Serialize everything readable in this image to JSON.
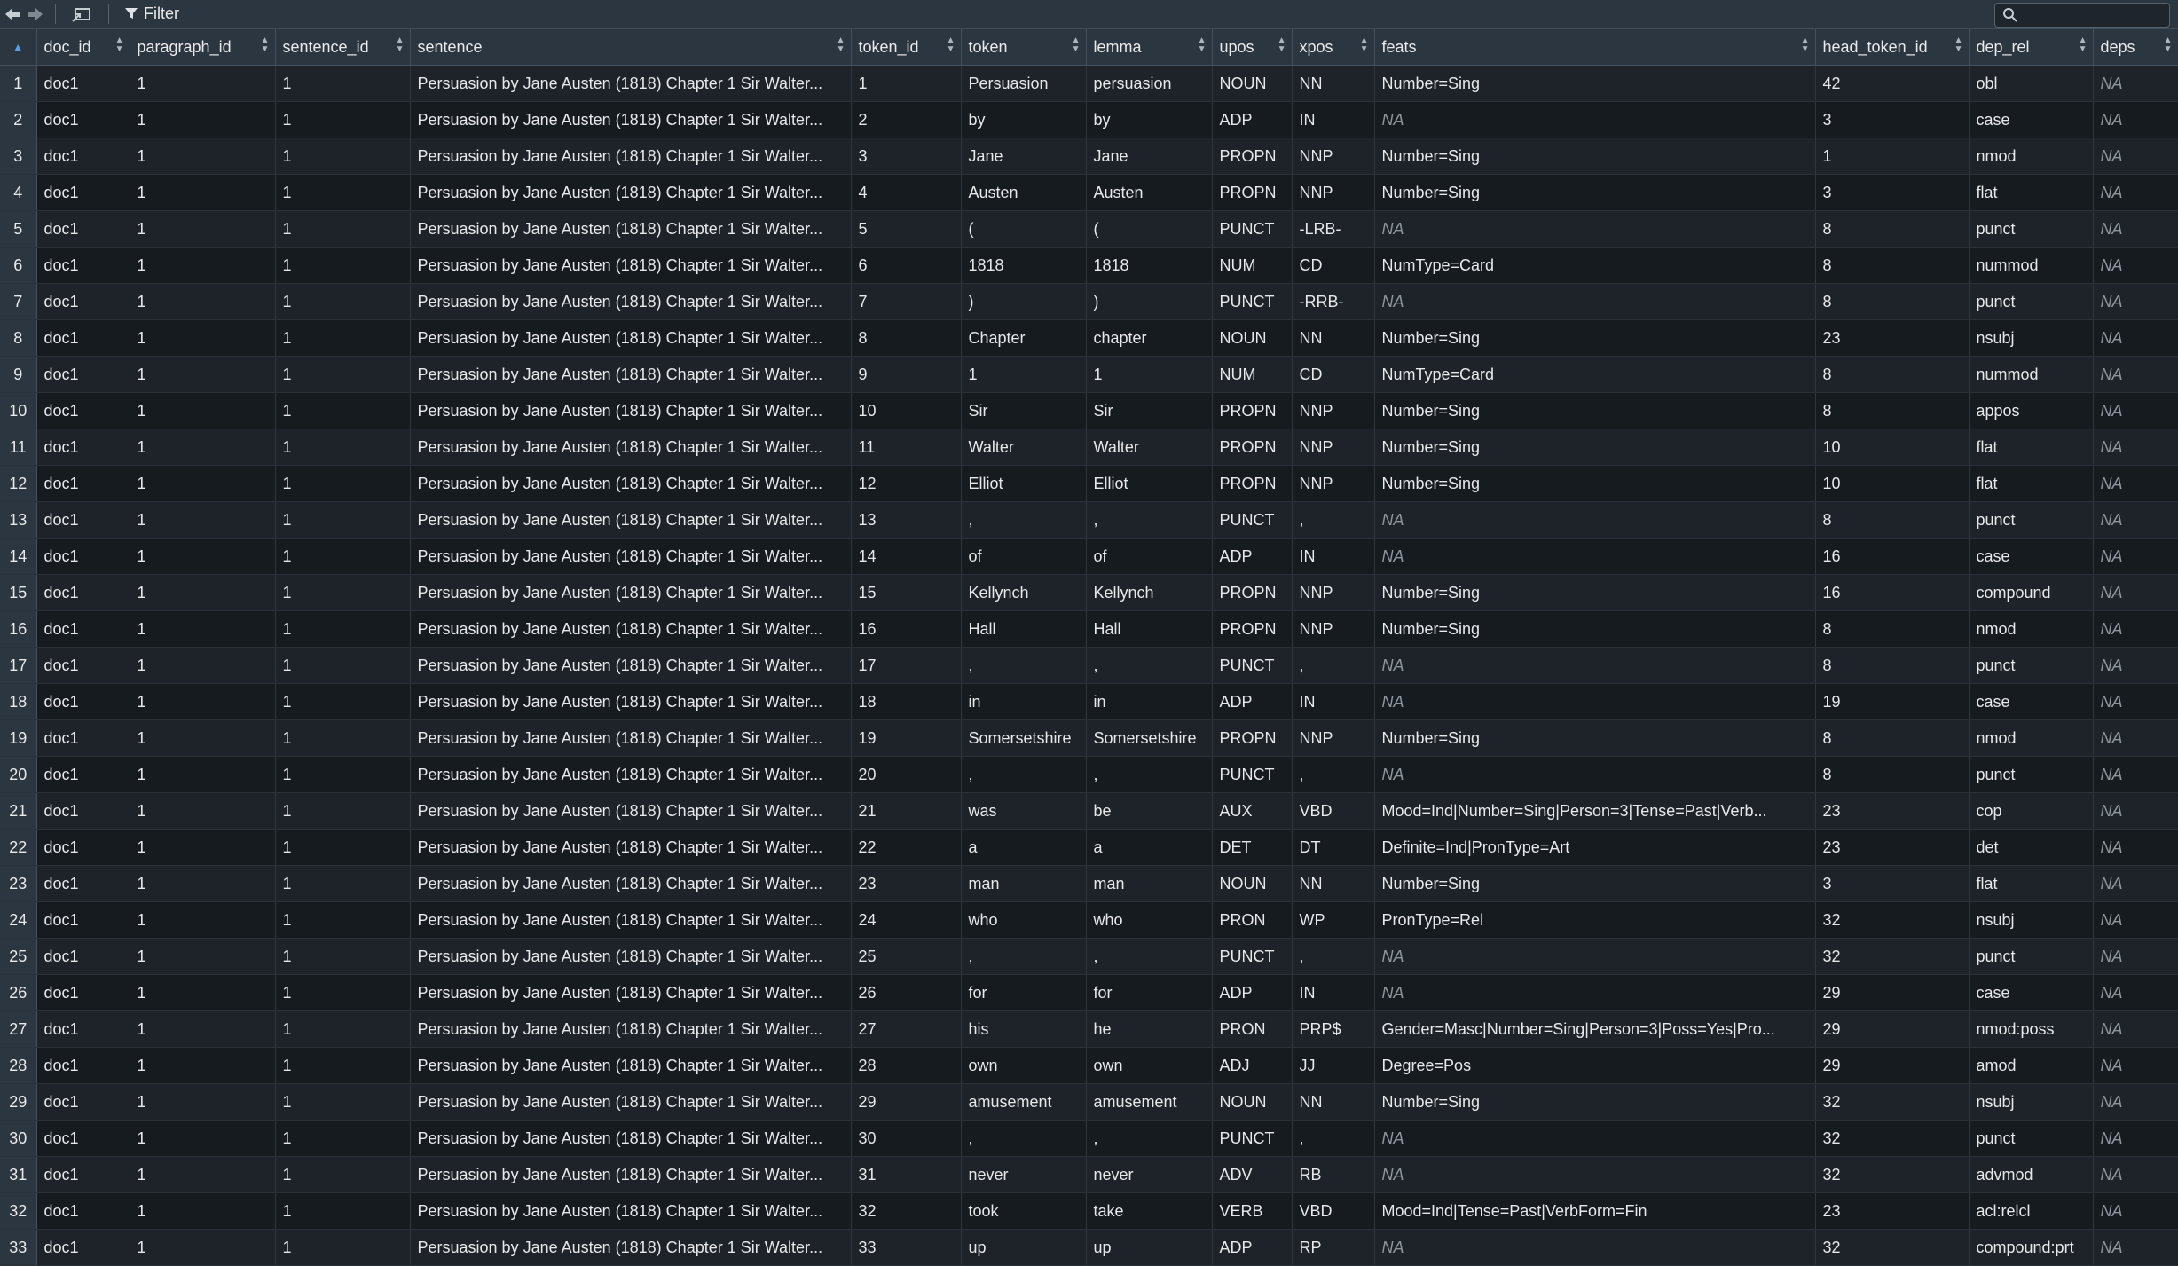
{
  "toolbar": {
    "filter_label": "Filter",
    "search_placeholder": ""
  },
  "columns": [
    "doc_id",
    "paragraph_id",
    "sentence_id",
    "sentence",
    "token_id",
    "token",
    "lemma",
    "upos",
    "xpos",
    "feats",
    "head_token_id",
    "dep_rel",
    "deps"
  ],
  "rows": [
    [
      "doc1",
      "1",
      "1",
      "Persuasion by Jane Austen (1818) Chapter 1 Sir Walter...",
      "1",
      "Persuasion",
      "persuasion",
      "NOUN",
      "NN",
      "Number=Sing",
      "42",
      "obl",
      "NA"
    ],
    [
      "doc1",
      "1",
      "1",
      "Persuasion by Jane Austen (1818) Chapter 1 Sir Walter...",
      "2",
      "by",
      "by",
      "ADP",
      "IN",
      "NA",
      "3",
      "case",
      "NA"
    ],
    [
      "doc1",
      "1",
      "1",
      "Persuasion by Jane Austen (1818) Chapter 1 Sir Walter...",
      "3",
      "Jane",
      "Jane",
      "PROPN",
      "NNP",
      "Number=Sing",
      "1",
      "nmod",
      "NA"
    ],
    [
      "doc1",
      "1",
      "1",
      "Persuasion by Jane Austen (1818) Chapter 1 Sir Walter...",
      "4",
      "Austen",
      "Austen",
      "PROPN",
      "NNP",
      "Number=Sing",
      "3",
      "flat",
      "NA"
    ],
    [
      "doc1",
      "1",
      "1",
      "Persuasion by Jane Austen (1818) Chapter 1 Sir Walter...",
      "5",
      "(",
      "(",
      "PUNCT",
      "-LRB-",
      "NA",
      "8",
      "punct",
      "NA"
    ],
    [
      "doc1",
      "1",
      "1",
      "Persuasion by Jane Austen (1818) Chapter 1 Sir Walter...",
      "6",
      "1818",
      "1818",
      "NUM",
      "CD",
      "NumType=Card",
      "8",
      "nummod",
      "NA"
    ],
    [
      "doc1",
      "1",
      "1",
      "Persuasion by Jane Austen (1818) Chapter 1 Sir Walter...",
      "7",
      ")",
      ")",
      "PUNCT",
      "-RRB-",
      "NA",
      "8",
      "punct",
      "NA"
    ],
    [
      "doc1",
      "1",
      "1",
      "Persuasion by Jane Austen (1818) Chapter 1 Sir Walter...",
      "8",
      "Chapter",
      "chapter",
      "NOUN",
      "NN",
      "Number=Sing",
      "23",
      "nsubj",
      "NA"
    ],
    [
      "doc1",
      "1",
      "1",
      "Persuasion by Jane Austen (1818) Chapter 1 Sir Walter...",
      "9",
      "1",
      "1",
      "NUM",
      "CD",
      "NumType=Card",
      "8",
      "nummod",
      "NA"
    ],
    [
      "doc1",
      "1",
      "1",
      "Persuasion by Jane Austen (1818) Chapter 1 Sir Walter...",
      "10",
      "Sir",
      "Sir",
      "PROPN",
      "NNP",
      "Number=Sing",
      "8",
      "appos",
      "NA"
    ],
    [
      "doc1",
      "1",
      "1",
      "Persuasion by Jane Austen (1818) Chapter 1 Sir Walter...",
      "11",
      "Walter",
      "Walter",
      "PROPN",
      "NNP",
      "Number=Sing",
      "10",
      "flat",
      "NA"
    ],
    [
      "doc1",
      "1",
      "1",
      "Persuasion by Jane Austen (1818) Chapter 1 Sir Walter...",
      "12",
      "Elliot",
      "Elliot",
      "PROPN",
      "NNP",
      "Number=Sing",
      "10",
      "flat",
      "NA"
    ],
    [
      "doc1",
      "1",
      "1",
      "Persuasion by Jane Austen (1818) Chapter 1 Sir Walter...",
      "13",
      ",",
      ",",
      "PUNCT",
      ",",
      "NA",
      "8",
      "punct",
      "NA"
    ],
    [
      "doc1",
      "1",
      "1",
      "Persuasion by Jane Austen (1818) Chapter 1 Sir Walter...",
      "14",
      "of",
      "of",
      "ADP",
      "IN",
      "NA",
      "16",
      "case",
      "NA"
    ],
    [
      "doc1",
      "1",
      "1",
      "Persuasion by Jane Austen (1818) Chapter 1 Sir Walter...",
      "15",
      "Kellynch",
      "Kellynch",
      "PROPN",
      "NNP",
      "Number=Sing",
      "16",
      "compound",
      "NA"
    ],
    [
      "doc1",
      "1",
      "1",
      "Persuasion by Jane Austen (1818) Chapter 1 Sir Walter...",
      "16",
      "Hall",
      "Hall",
      "PROPN",
      "NNP",
      "Number=Sing",
      "8",
      "nmod",
      "NA"
    ],
    [
      "doc1",
      "1",
      "1",
      "Persuasion by Jane Austen (1818) Chapter 1 Sir Walter...",
      "17",
      ",",
      ",",
      "PUNCT",
      ",",
      "NA",
      "8",
      "punct",
      "NA"
    ],
    [
      "doc1",
      "1",
      "1",
      "Persuasion by Jane Austen (1818) Chapter 1 Sir Walter...",
      "18",
      "in",
      "in",
      "ADP",
      "IN",
      "NA",
      "19",
      "case",
      "NA"
    ],
    [
      "doc1",
      "1",
      "1",
      "Persuasion by Jane Austen (1818) Chapter 1 Sir Walter...",
      "19",
      "Somersetshire",
      "Somersetshire",
      "PROPN",
      "NNP",
      "Number=Sing",
      "8",
      "nmod",
      "NA"
    ],
    [
      "doc1",
      "1",
      "1",
      "Persuasion by Jane Austen (1818) Chapter 1 Sir Walter...",
      "20",
      ",",
      ",",
      "PUNCT",
      ",",
      "NA",
      "8",
      "punct",
      "NA"
    ],
    [
      "doc1",
      "1",
      "1",
      "Persuasion by Jane Austen (1818) Chapter 1 Sir Walter...",
      "21",
      "was",
      "be",
      "AUX",
      "VBD",
      "Mood=Ind|Number=Sing|Person=3|Tense=Past|Verb...",
      "23",
      "cop",
      "NA"
    ],
    [
      "doc1",
      "1",
      "1",
      "Persuasion by Jane Austen (1818) Chapter 1 Sir Walter...",
      "22",
      "a",
      "a",
      "DET",
      "DT",
      "Definite=Ind|PronType=Art",
      "23",
      "det",
      "NA"
    ],
    [
      "doc1",
      "1",
      "1",
      "Persuasion by Jane Austen (1818) Chapter 1 Sir Walter...",
      "23",
      "man",
      "man",
      "NOUN",
      "NN",
      "Number=Sing",
      "3",
      "flat",
      "NA"
    ],
    [
      "doc1",
      "1",
      "1",
      "Persuasion by Jane Austen (1818) Chapter 1 Sir Walter...",
      "24",
      "who",
      "who",
      "PRON",
      "WP",
      "PronType=Rel",
      "32",
      "nsubj",
      "NA"
    ],
    [
      "doc1",
      "1",
      "1",
      "Persuasion by Jane Austen (1818) Chapter 1 Sir Walter...",
      "25",
      ",",
      ",",
      "PUNCT",
      ",",
      "NA",
      "32",
      "punct",
      "NA"
    ],
    [
      "doc1",
      "1",
      "1",
      "Persuasion by Jane Austen (1818) Chapter 1 Sir Walter...",
      "26",
      "for",
      "for",
      "ADP",
      "IN",
      "NA",
      "29",
      "case",
      "NA"
    ],
    [
      "doc1",
      "1",
      "1",
      "Persuasion by Jane Austen (1818) Chapter 1 Sir Walter...",
      "27",
      "his",
      "he",
      "PRON",
      "PRP$",
      "Gender=Masc|Number=Sing|Person=3|Poss=Yes|Pro...",
      "29",
      "nmod:poss",
      "NA"
    ],
    [
      "doc1",
      "1",
      "1",
      "Persuasion by Jane Austen (1818) Chapter 1 Sir Walter...",
      "28",
      "own",
      "own",
      "ADJ",
      "JJ",
      "Degree=Pos",
      "29",
      "amod",
      "NA"
    ],
    [
      "doc1",
      "1",
      "1",
      "Persuasion by Jane Austen (1818) Chapter 1 Sir Walter...",
      "29",
      "amusement",
      "amusement",
      "NOUN",
      "NN",
      "Number=Sing",
      "32",
      "nsubj",
      "NA"
    ],
    [
      "doc1",
      "1",
      "1",
      "Persuasion by Jane Austen (1818) Chapter 1 Sir Walter...",
      "30",
      ",",
      ",",
      "PUNCT",
      ",",
      "NA",
      "32",
      "punct",
      "NA"
    ],
    [
      "doc1",
      "1",
      "1",
      "Persuasion by Jane Austen (1818) Chapter 1 Sir Walter...",
      "31",
      "never",
      "never",
      "ADV",
      "RB",
      "NA",
      "32",
      "advmod",
      "NA"
    ],
    [
      "doc1",
      "1",
      "1",
      "Persuasion by Jane Austen (1818) Chapter 1 Sir Walter...",
      "32",
      "took",
      "take",
      "VERB",
      "VBD",
      "Mood=Ind|Tense=Past|VerbForm=Fin",
      "23",
      "acl:relcl",
      "NA"
    ],
    [
      "doc1",
      "1",
      "1",
      "Persuasion by Jane Austen (1818) Chapter 1 Sir Walter...",
      "33",
      "up",
      "up",
      "ADP",
      "RP",
      "NA",
      "32",
      "compound:prt",
      "NA"
    ]
  ]
}
